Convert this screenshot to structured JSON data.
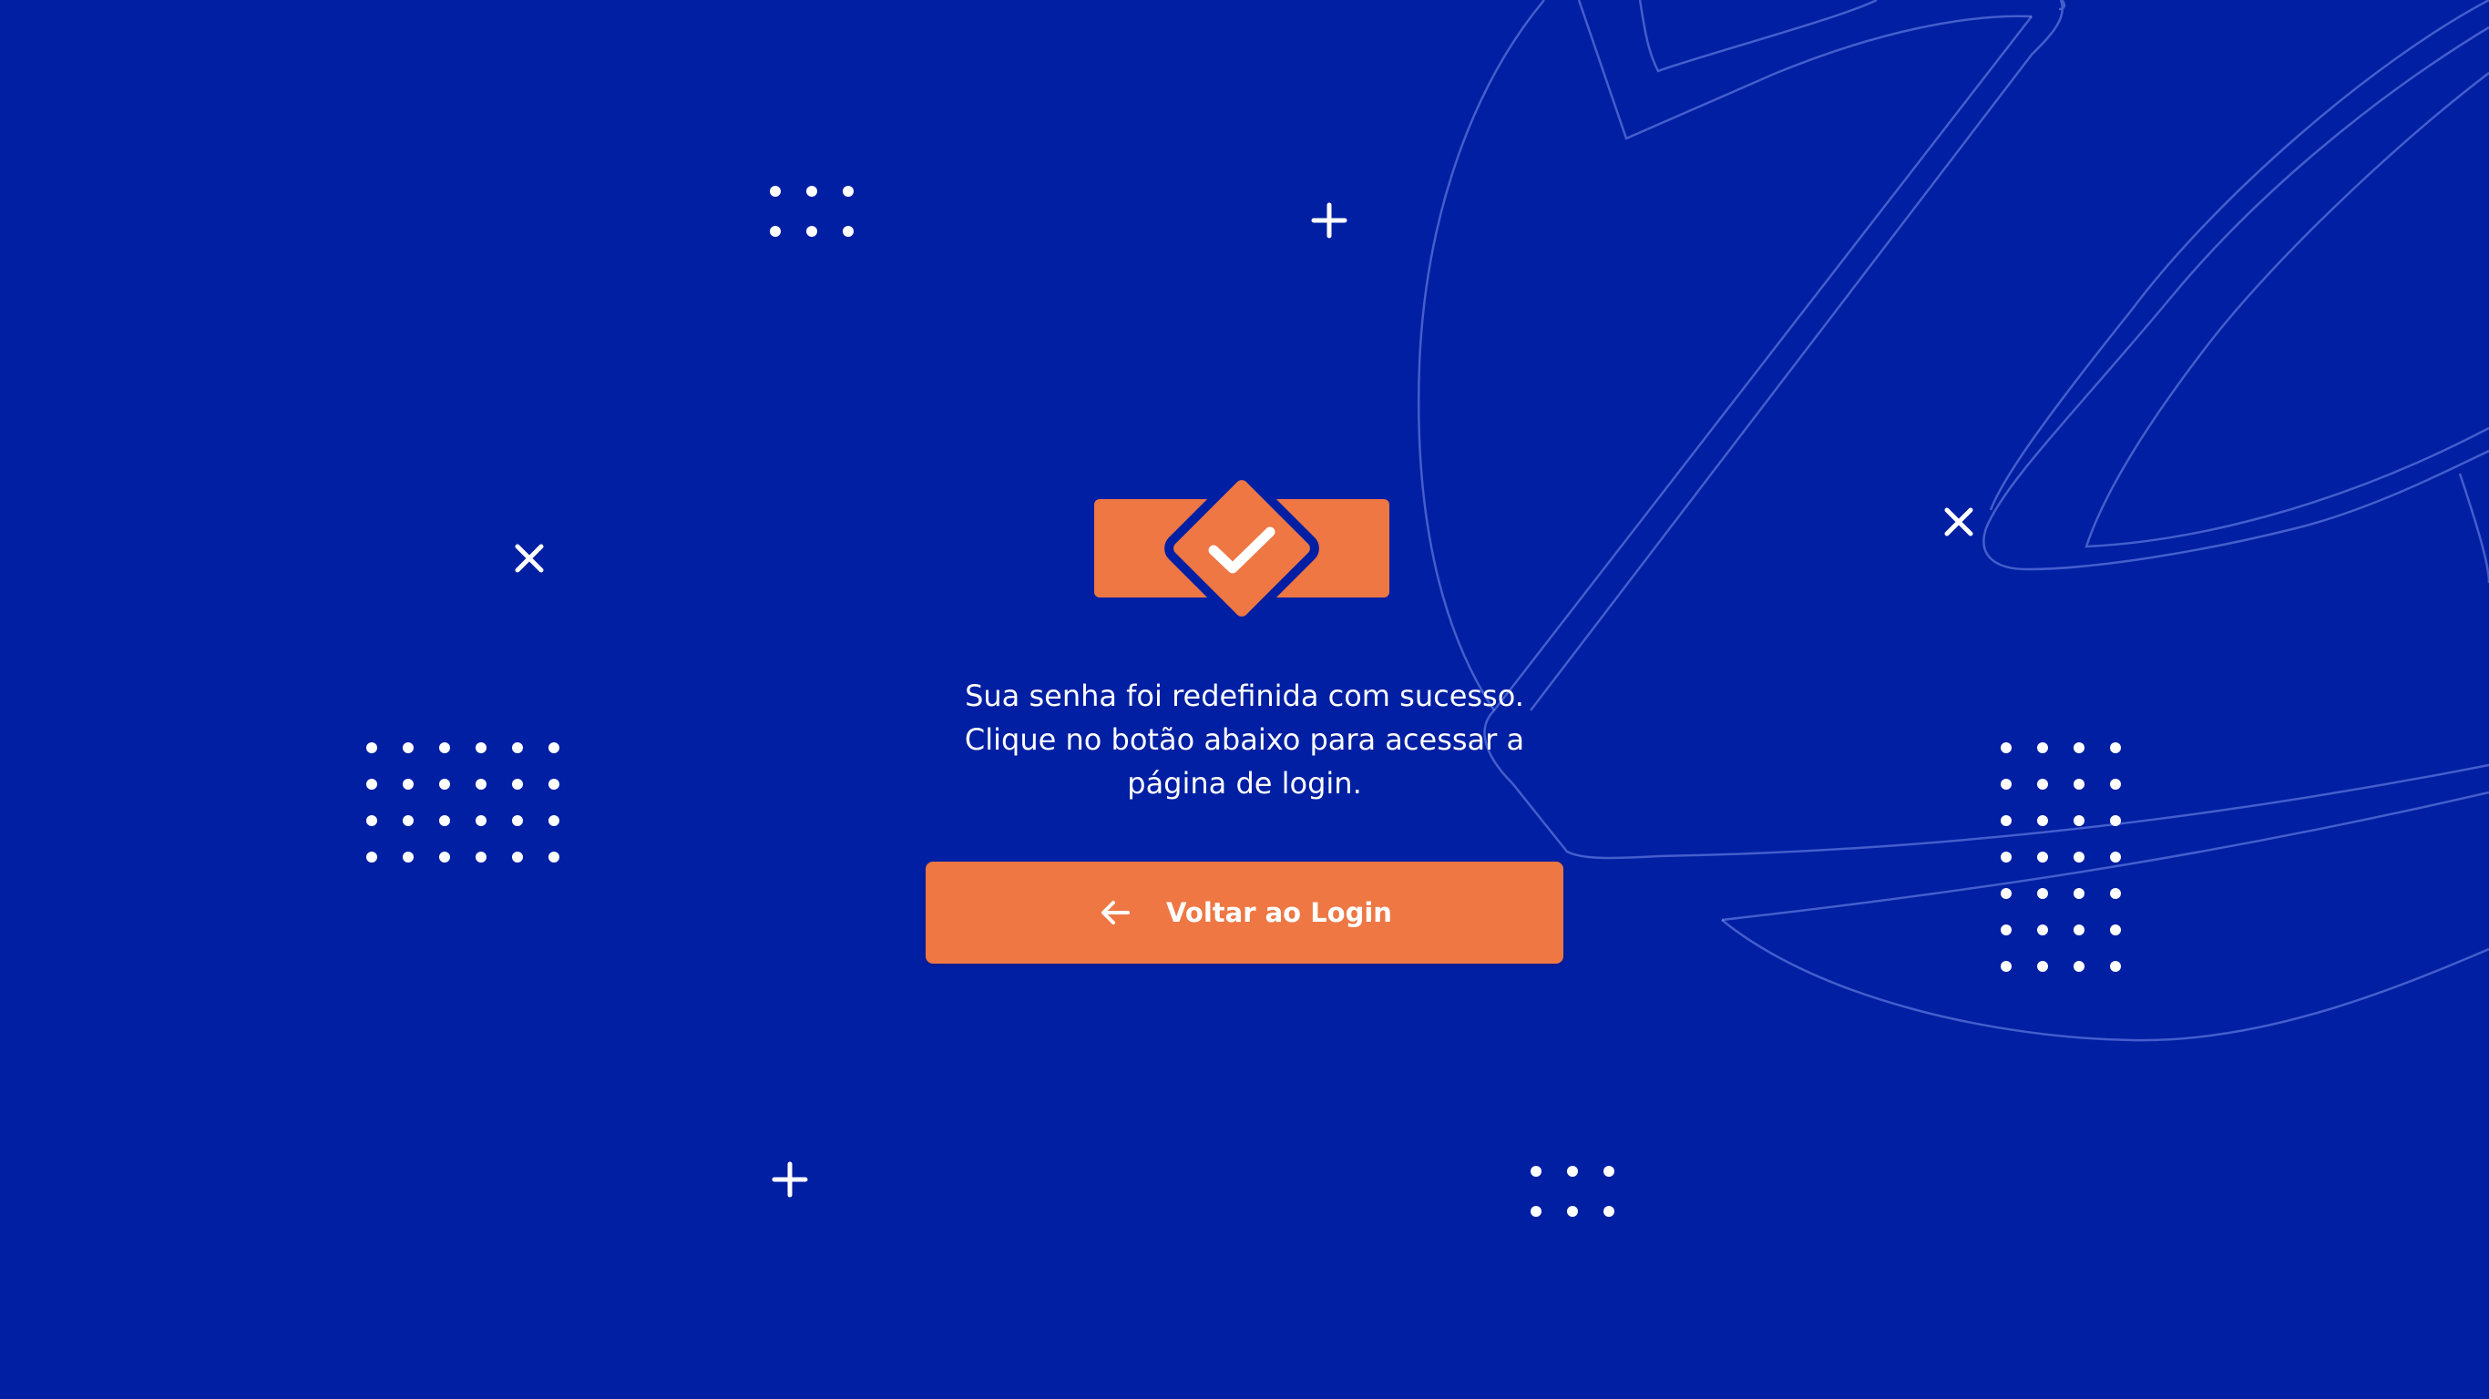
{
  "page": {
    "background_color": "#001FA3",
    "accent_color": "#EE7744"
  },
  "success": {
    "icon": "check-badge-icon",
    "message": "Sua senha foi redefinida com sucesso. Clique no botão abaixo para acessar a página de login."
  },
  "button": {
    "label": "Voltar ao Login",
    "icon": "arrow-left-icon"
  }
}
